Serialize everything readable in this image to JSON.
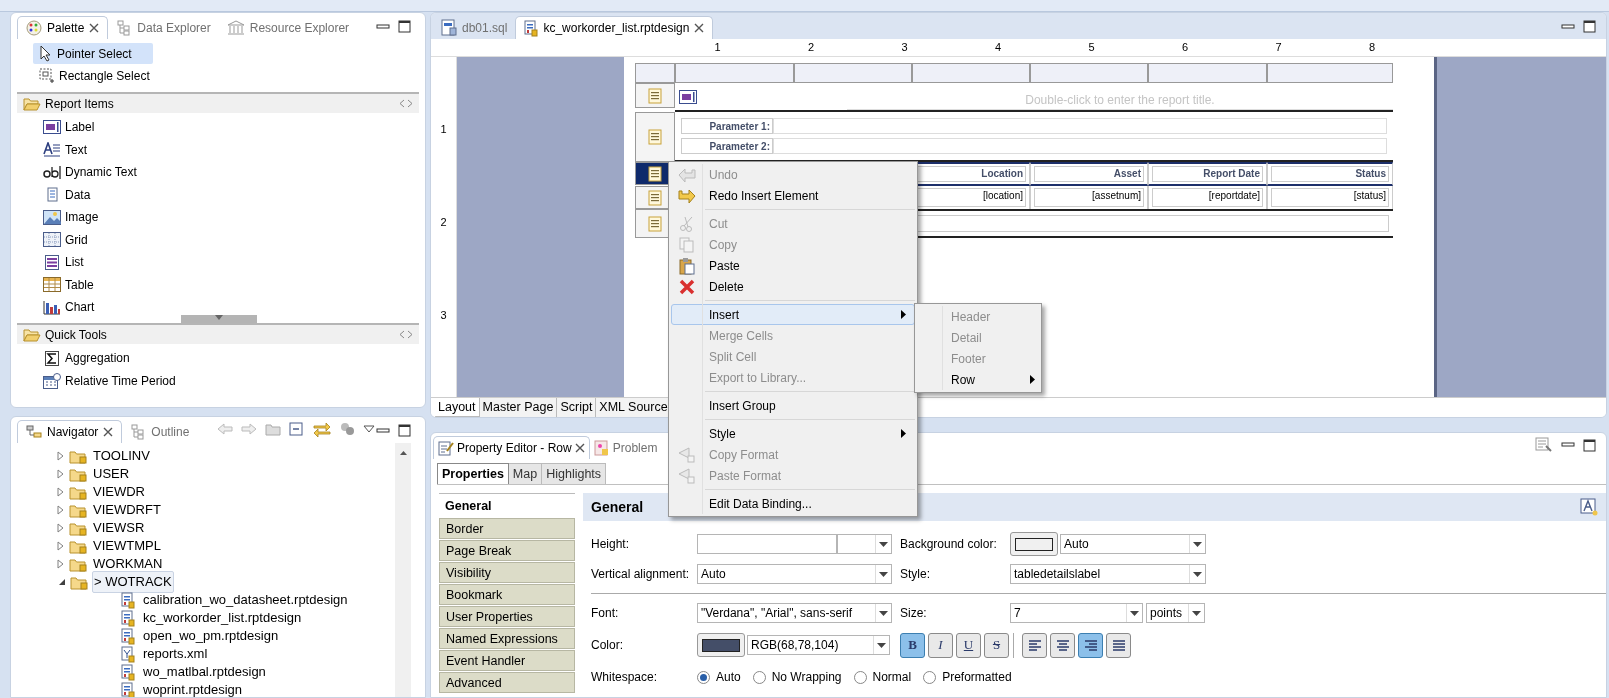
{
  "palette": {
    "tabs": [
      {
        "label": "Palette",
        "selected": true
      },
      {
        "label": "Data Explorer",
        "selected": false
      },
      {
        "label": "Resource Explorer",
        "selected": false
      }
    ],
    "tools": [
      {
        "label": "Pointer Select",
        "selected": true
      },
      {
        "label": "Rectangle Select",
        "selected": false
      }
    ],
    "drawers": [
      {
        "title": "Report Items",
        "items": [
          "Label",
          "Text",
          "Dynamic Text",
          "Data",
          "Image",
          "Grid",
          "List",
          "Table",
          "Chart"
        ]
      },
      {
        "title": "Quick Tools",
        "items": [
          "Aggregation",
          "Relative Time Period"
        ]
      }
    ]
  },
  "navigator": {
    "tabs": [
      {
        "label": "Navigator",
        "selected": true
      },
      {
        "label": "Outline",
        "selected": false
      }
    ],
    "tree": [
      {
        "label": "TOOLINV",
        "expanded": false,
        "selected": false
      },
      {
        "label": "USER",
        "expanded": false,
        "selected": false
      },
      {
        "label": "VIEWDR",
        "expanded": false,
        "selected": false
      },
      {
        "label": "VIEWDRFT",
        "expanded": false,
        "selected": false
      },
      {
        "label": "VIEWSR",
        "expanded": false,
        "selected": false
      },
      {
        "label": "VIEWTMPL",
        "expanded": false,
        "selected": false
      },
      {
        "label": "WORKMAN",
        "expanded": false,
        "selected": false
      },
      {
        "label": "> WOTRACK",
        "expanded": true,
        "selected": true,
        "children": [
          {
            "label": "calibration_wo_datasheet.rptdesign",
            "kind": "report",
            "selected": false
          },
          {
            "label": "kc_workorder_list.rptdesign",
            "kind": "report",
            "selected": false
          },
          {
            "label": "open_wo_pm.rptdesign",
            "kind": "report",
            "selected": false
          },
          {
            "label": "reports.xml",
            "kind": "xml",
            "selected": false
          },
          {
            "label": "wo_matlbal.rptdesign",
            "kind": "report",
            "selected": false
          },
          {
            "label": "woprint.rptdesign",
            "kind": "report",
            "selected": false
          }
        ]
      }
    ]
  },
  "editor": {
    "tabs": [
      {
        "label": "db01.sql",
        "selected": false
      },
      {
        "label": "kc_workorder_list.rptdesign",
        "selected": true
      }
    ],
    "ruler": {
      "horizontal": [
        "1",
        "2",
        "3",
        "4",
        "5",
        "6",
        "7",
        "8"
      ],
      "vertical": [
        "1",
        "2",
        "3"
      ]
    },
    "report": {
      "title_placeholder": "Double-click to enter the report title.",
      "parameters": [
        "Parameter 1:",
        "Parameter 2:"
      ],
      "header_row": {
        "selected": true,
        "cells": [
          "Location",
          "Asset",
          "Report Date",
          "Status"
        ]
      },
      "detail_row": {
        "selected": false,
        "cells": [
          "[location]",
          "[assetnum]",
          "[reportdate]",
          "[status]"
        ]
      }
    },
    "bottom_tabs": [
      {
        "label": "Layout",
        "selected": true
      },
      {
        "label": "Master Page",
        "selected": false
      },
      {
        "label": "Script",
        "selected": false
      },
      {
        "label": "XML Source",
        "selected": false
      }
    ]
  },
  "context_menu": {
    "items": [
      {
        "kind": "item",
        "label": "Undo",
        "disabled": true,
        "highlighted": false,
        "submenu": false
      },
      {
        "kind": "item",
        "label": "Redo Insert Element",
        "disabled": false,
        "highlighted": false,
        "submenu": false
      },
      {
        "kind": "separator"
      },
      {
        "kind": "item",
        "label": "Cut",
        "disabled": true,
        "highlighted": false,
        "submenu": false
      },
      {
        "kind": "item",
        "label": "Copy",
        "disabled": true,
        "highlighted": false,
        "submenu": false
      },
      {
        "kind": "item",
        "label": "Paste",
        "disabled": false,
        "highlighted": false,
        "submenu": false
      },
      {
        "kind": "item",
        "label": "Delete",
        "disabled": false,
        "highlighted": false,
        "submenu": false
      },
      {
        "kind": "separator"
      },
      {
        "kind": "item",
        "label": "Insert",
        "disabled": false,
        "highlighted": true,
        "submenu": true
      },
      {
        "kind": "item",
        "label": "Merge Cells",
        "disabled": true,
        "highlighted": false,
        "submenu": false
      },
      {
        "kind": "item",
        "label": "Split Cell",
        "disabled": true,
        "highlighted": false,
        "submenu": false
      },
      {
        "kind": "item",
        "label": "Export to Library...",
        "disabled": true,
        "highlighted": false,
        "submenu": false
      },
      {
        "kind": "separator"
      },
      {
        "kind": "item",
        "label": "Insert Group",
        "disabled": false,
        "highlighted": false,
        "submenu": false
      },
      {
        "kind": "separator"
      },
      {
        "kind": "item",
        "label": "Style",
        "disabled": false,
        "highlighted": false,
        "submenu": true
      },
      {
        "kind": "item",
        "label": "Copy Format",
        "disabled": true,
        "highlighted": false,
        "submenu": false
      },
      {
        "kind": "item",
        "label": "Paste Format",
        "disabled": true,
        "highlighted": false,
        "submenu": false
      },
      {
        "kind": "separator"
      },
      {
        "kind": "item",
        "label": "Edit Data Binding...",
        "disabled": false,
        "highlighted": false,
        "submenu": false
      }
    ],
    "submenu": [
      {
        "label": "Header",
        "disabled": true,
        "submenu": false
      },
      {
        "label": "Detail",
        "disabled": true,
        "submenu": false
      },
      {
        "label": "Footer",
        "disabled": true,
        "submenu": false
      },
      {
        "label": "Row",
        "disabled": false,
        "submenu": true
      }
    ]
  },
  "property_editor": {
    "tabs": [
      {
        "label": "Property Editor - Row",
        "selected": true
      },
      {
        "label": "Problem",
        "selected": false
      }
    ],
    "subtabs": [
      {
        "label": "Properties",
        "selected": true
      },
      {
        "label": "Map",
        "selected": false
      },
      {
        "label": "Highlights",
        "selected": false
      }
    ],
    "categories": [
      {
        "label": "General",
        "selected": true
      },
      {
        "label": "Border",
        "selected": false
      },
      {
        "label": "Page Break",
        "selected": false
      },
      {
        "label": "Visibility",
        "selected": false
      },
      {
        "label": "Bookmark",
        "selected": false
      },
      {
        "label": "User Properties",
        "selected": false
      },
      {
        "label": "Named Expressions",
        "selected": false
      },
      {
        "label": "Event Handler",
        "selected": false
      },
      {
        "label": "Advanced",
        "selected": false
      }
    ],
    "section_title": "General",
    "height": {
      "label": "Height:"
    },
    "background_color": {
      "label": "Background color:",
      "value": "Auto"
    },
    "vertical_alignment": {
      "label": "Vertical alignment:",
      "value": "Auto"
    },
    "style": {
      "label": "Style:",
      "value": "tabledetailslabel"
    },
    "font": {
      "label": "Font:",
      "value": "\"Verdana\", \"Arial\", sans-serif"
    },
    "size": {
      "label": "Size:",
      "value": "7",
      "unit": "points"
    },
    "color": {
      "label": "Color:",
      "value": "RGB(68,78,104)"
    },
    "format_buttons": [
      {
        "label": "B",
        "selected": true
      },
      {
        "label": "I",
        "selected": false
      },
      {
        "label": "U",
        "selected": false
      },
      {
        "label": "S",
        "selected": false
      }
    ],
    "align_buttons": [
      {
        "selected": false
      },
      {
        "selected": false
      },
      {
        "selected": true
      },
      {
        "selected": false
      }
    ],
    "whitespace": {
      "label": "Whitespace:",
      "options": [
        {
          "label": "Auto",
          "selected": true
        },
        {
          "label": "No Wrapping",
          "selected": false
        },
        {
          "label": "Normal",
          "selected": false
        },
        {
          "label": "Preformatted",
          "selected": false
        }
      ]
    }
  }
}
